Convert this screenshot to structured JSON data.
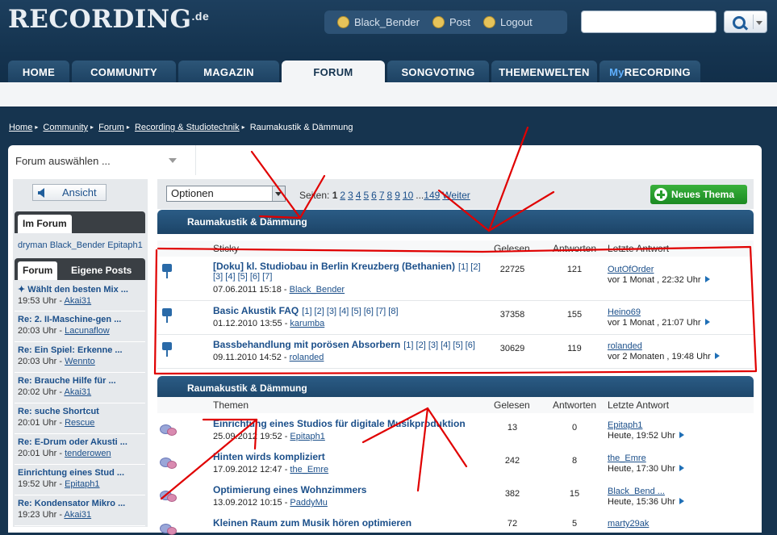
{
  "header": {
    "logo": "RECORDING",
    "logo_tld": ".de",
    "user": "Black_Bender",
    "post": "Post",
    "logout": "Logout"
  },
  "nav": {
    "tabs": [
      "HOME",
      "COMMUNITY",
      "MAGAZIN",
      "FORUM",
      "SONGVOTING",
      "THEMENWELTEN"
    ],
    "my_prefix": "My",
    "my_suffix": "RECORDING",
    "active": "FORUM"
  },
  "breadcrumb": {
    "links": [
      "Home",
      "Community",
      "Forum",
      "Recording & Studiotechnik"
    ],
    "current": "Raumakustik & Dämmung"
  },
  "forum_select": {
    "label": "Forum auswählen ..."
  },
  "sidebar": {
    "ansicht": "Ansicht",
    "im_forum_tab": "Im Forum",
    "online_users": "dryman Black_Bender Epitaph1",
    "tab_forum": "Forum",
    "tab_eigene": "Eigene Posts",
    "items": [
      {
        "title": "✦ Wählt den besten Mix ...",
        "time": "19:53 Uhr - ",
        "user": "Akai31"
      },
      {
        "title": "Re: 2. II-Maschine-gen ...",
        "time": "20:03 Uhr - ",
        "user": "Lacunaflow"
      },
      {
        "title": "Re: Ein Spiel: Erkenne ...",
        "time": "20:03 Uhr - ",
        "user": "Wennto"
      },
      {
        "title": "Re: Brauche Hilfe für ...",
        "time": "20:02 Uhr - ",
        "user": "Akai31"
      },
      {
        "title": "Re: suche Shortcut",
        "time": "20:01 Uhr - ",
        "user": "Rescue"
      },
      {
        "title": "Re: E-Drum oder Akusti ...",
        "time": "20:01 Uhr - ",
        "user": "tenderowen"
      },
      {
        "title": "Einrichtung eines Stud ...",
        "time": "19:52 Uhr - ",
        "user": "Epitaph1"
      },
      {
        "title": "Re: Kondensator Mikro ...",
        "time": "19:23 Uhr - ",
        "user": "Akai31"
      }
    ]
  },
  "toolbar": {
    "options": "Optionen",
    "pages_label": "Seiten:",
    "current_page": "1",
    "pages": [
      "2",
      "3",
      "4",
      "5",
      "6",
      "7",
      "8",
      "9",
      "10"
    ],
    "ellipsis": "...",
    "last_page": "149",
    "next": "Weiter",
    "new_topic": "Neues Thema"
  },
  "sticky_section": {
    "title": "Raumakustik & Dämmung",
    "col_topic": "Sticky",
    "col_views": "Gelesen",
    "col_replies": "Antworten",
    "col_last": "Letzte Antwort",
    "rows": [
      {
        "title": "[Doku] kl. Studiobau in Berlin Kreuzberg (Bethanien)",
        "pages_a": "[1] [2]",
        "pages_b": "[3] [4] [5] [6] [7]",
        "date": "07.06.2011 15:18 - ",
        "author": "Black_Bender",
        "views": "22725",
        "replies": "121",
        "last_user": "OutOfOrder",
        "last_time": "vor 1 Monat , 22:32 Uhr"
      },
      {
        "title": "Basic Akustik FAQ",
        "pages_a": "[1] [2] [3] [4] [5] [6] [7] [8]",
        "date": "01.12.2010 13:55 - ",
        "author": "karumba",
        "views": "37358",
        "replies": "155",
        "last_user": "Heino69",
        "last_time": "vor 1 Monat , 21:07 Uhr"
      },
      {
        "title": "Bassbehandlung mit porösen Absorbern",
        "pages_a": "[1] [2] [3] [4] [5] [6]",
        "date": "09.11.2010 14:52 - ",
        "author": "rolanded",
        "views": "30629",
        "replies": "119",
        "last_user": "rolanded",
        "last_time": "vor 2 Monaten , 19:48 Uhr"
      }
    ]
  },
  "topics_section": {
    "title": "Raumakustik & Dämmung",
    "col_topic": "Themen",
    "col_views": "Gelesen",
    "col_replies": "Antworten",
    "col_last": "Letzte Antwort",
    "rows": [
      {
        "title": "Einrichtung eines Studios für digitale Musikproduktion",
        "date": "25.09.2012 19:52 - ",
        "author": "Epitaph1",
        "views": "13",
        "replies": "0",
        "last_user": "Epitaph1",
        "last_time": "Heute, 19:52 Uhr"
      },
      {
        "title": "Hinten wirds kompliziert",
        "date": "17.09.2012 12:47 - ",
        "author": "the_Emre",
        "views": "242",
        "replies": "8",
        "last_user": "the_Emre",
        "last_time": "Heute, 17:30 Uhr"
      },
      {
        "title": "Optimierung eines Wohnzimmers",
        "date": "13.09.2012 10:15 - ",
        "author": "PaddyMu",
        "views": "382",
        "replies": "15",
        "last_user": "Black_Bend ...",
        "last_time": "Heute, 15:36 Uhr"
      },
      {
        "title": "Kleinen Raum zum Musik hören optimieren",
        "date": "",
        "author": "",
        "views": "72",
        "replies": "5",
        "last_user": "marty29ak",
        "last_time": ""
      }
    ]
  },
  "annotation_color": "#e00000"
}
